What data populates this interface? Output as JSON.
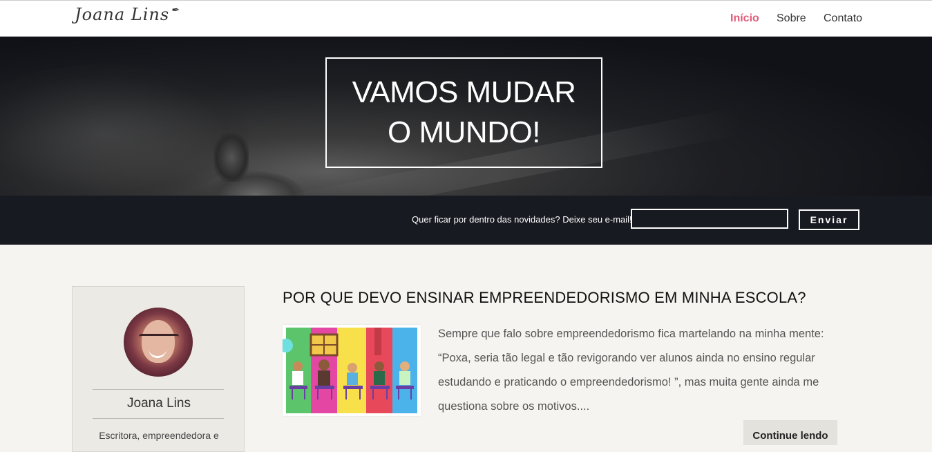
{
  "nav": {
    "logo": "Joana Lins",
    "links": [
      {
        "label": "Início",
        "active": true
      },
      {
        "label": "Sobre",
        "active": false
      },
      {
        "label": "Contato",
        "active": false
      }
    ],
    "accent_color": "#e05a77"
  },
  "hero": {
    "title_line1": "VAMOS MUDAR",
    "title_line2": "O MUNDO!"
  },
  "subscribe": {
    "label": "Quer ficar por dentro das novidades? Deixe seu e-mail!",
    "input_value": "",
    "button_label": "Enviar"
  },
  "sidebar": {
    "name": "Joana Lins",
    "description": "Escritora, empreendedora e"
  },
  "post": {
    "title": "POR QUE DEVO ENSINAR EMPREENDEDORISMO EM MINHA ESCOLA?",
    "excerpt": "Sempre que falo sobre empreendedorismo fica martelando na minha mente: “Poxa, seria tão legal e tão revigorando ver alunos ainda no ensino regular estudando e praticando o empreendedorismo! ”, mas muita gente ainda me questiona sobre os motivos....",
    "continue_label": "Continue lendo",
    "thumbnail_colors": [
      "#5cc46b",
      "#e447a3",
      "#f7e04a",
      "#e8495a",
      "#4bb3ea"
    ]
  }
}
